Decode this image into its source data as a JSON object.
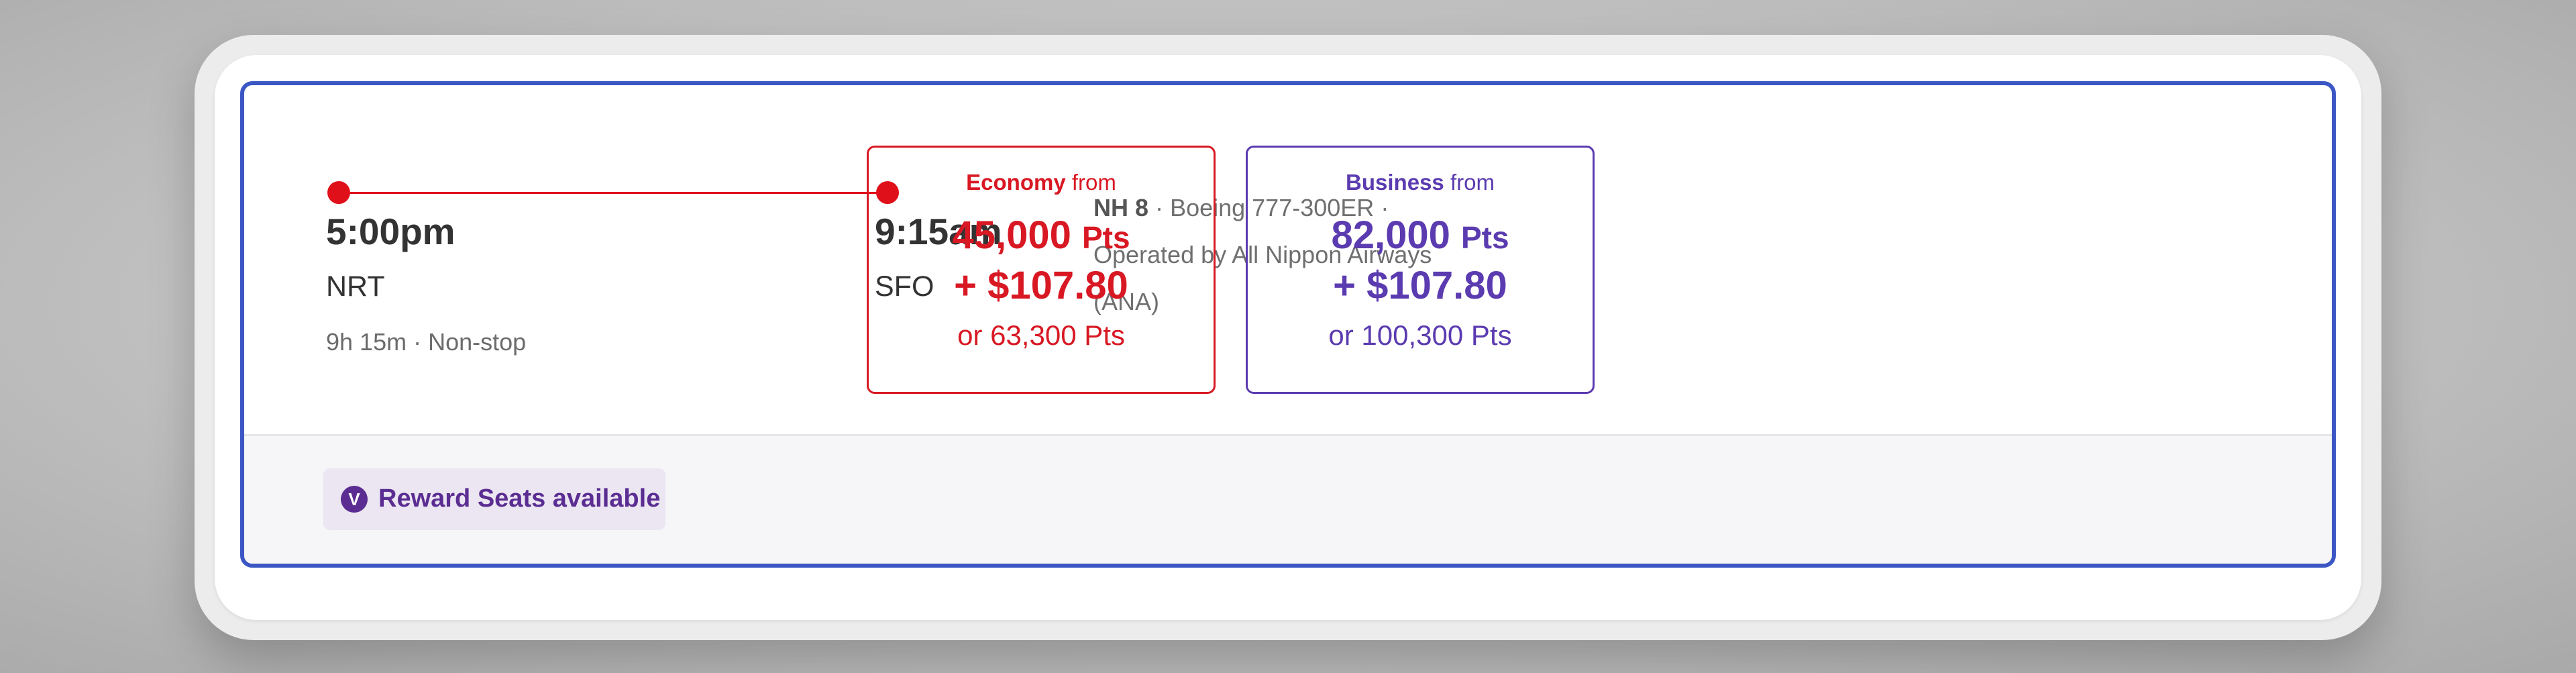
{
  "flight": {
    "departure": {
      "time": "5:00pm",
      "airport": "NRT"
    },
    "arrival": {
      "time": "9:15am",
      "airport": "SFO"
    },
    "duration": "9h 15m",
    "stops": "Non-stop",
    "separator": "·",
    "number": "NH 8",
    "aircraft": "Boeing 777-300ER",
    "operated_by_line1": "Operated by All Nippon Airways",
    "operated_by_line2": "(ANA)"
  },
  "fares": [
    {
      "cabin": "Economy",
      "from_label": "from",
      "points": "45,000",
      "points_unit": "Pts",
      "cash": "+ $107.80",
      "alternative": "or 63,300 Pts",
      "color": "#d81823"
    },
    {
      "cabin": "Business",
      "from_label": "from",
      "points": "82,000",
      "points_unit": "Pts",
      "cash": "+ $107.80",
      "alternative": "or 100,300 Pts",
      "color": "#5b3bb0"
    }
  ],
  "footer": {
    "badge_icon_letter": "V",
    "badge_label": "Reward Seats available",
    "badge_color": "#5b2d92"
  },
  "colors": {
    "route": "#e0101a",
    "card_border": "#3b57c4"
  }
}
